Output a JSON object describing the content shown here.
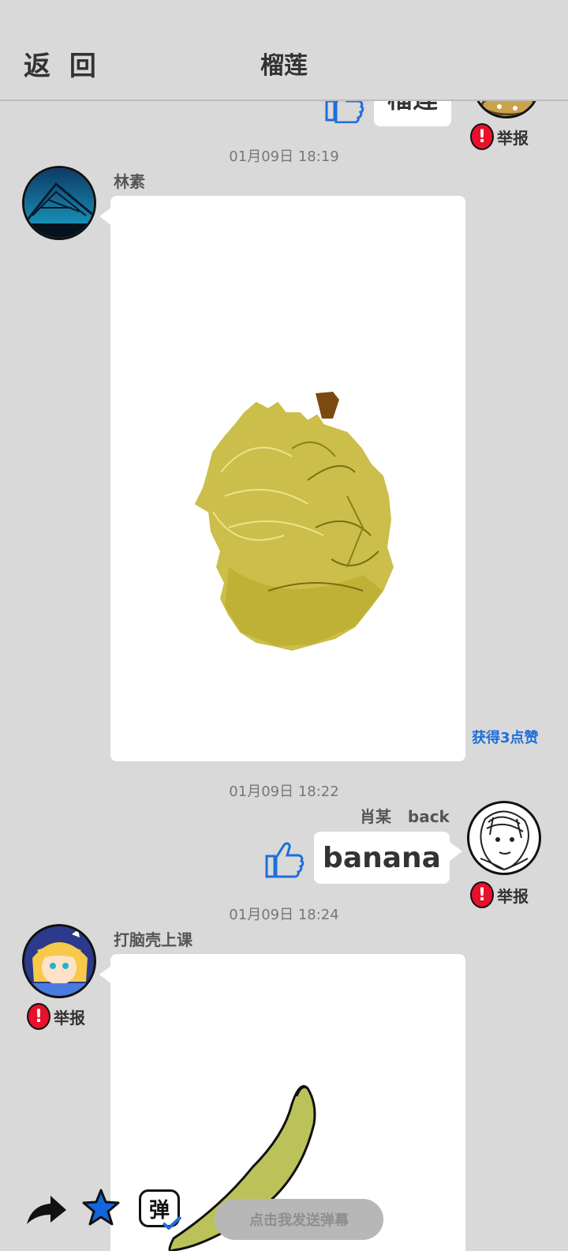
{
  "header": {
    "back_label": "返 回",
    "title": "榴莲"
  },
  "messages": [
    {
      "type": "guess-partial",
      "side": "right",
      "guess_text": "榴莲",
      "report_label": "举报"
    },
    {
      "type": "drawing",
      "side": "left",
      "timestamp": "01月09日  18:19",
      "author": "林素",
      "drawing_subject_icon": "durian-drawing",
      "likes_label": "获得3点赞"
    },
    {
      "type": "guess",
      "side": "right",
      "timestamp": "01月09日  18:22",
      "author": "肖某   back",
      "guess_text": "banana",
      "report_label": "举报"
    },
    {
      "type": "drawing",
      "side": "left",
      "timestamp": "01月09日  18:24",
      "author": "打脑壳上课",
      "report_label": "举报",
      "drawing_subject_icon": "banana-drawing"
    }
  ],
  "toolbar": {
    "share_icon": "share-arrow-icon",
    "favorite_icon": "star-icon",
    "danmaku_toggle_icon": "danmaku-toggle-icon",
    "danmaku_toggle_glyph": "弹",
    "danmaku_placeholder": "点击我发送弹幕"
  },
  "colors": {
    "background": "#d9d9d9",
    "report_red": "#e8102a",
    "link_blue": "#1e6fd9",
    "star_blue": "#1166dd"
  }
}
